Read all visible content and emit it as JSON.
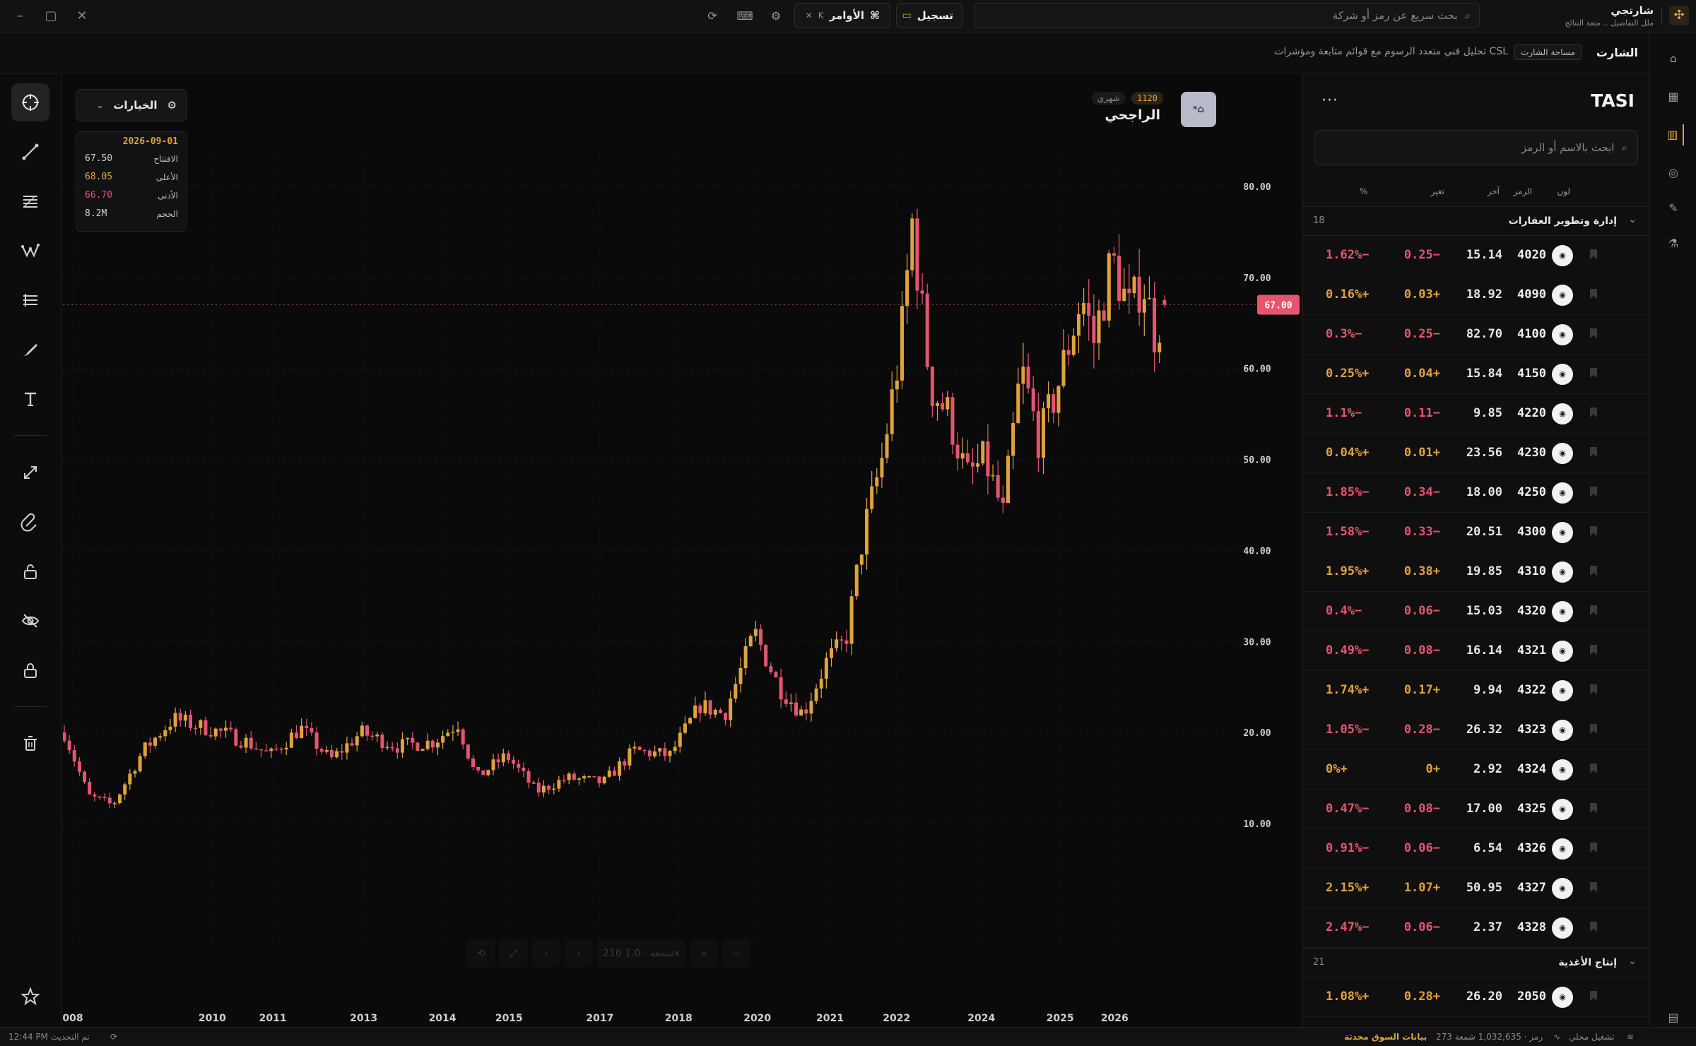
{
  "brand": {
    "name": "شارتجي",
    "tagline": "ملل التفاصيل .. متعة النتائج"
  },
  "topbar": {
    "search_placeholder": "بحث سريع عن رمز أو شركة",
    "record_label": "تسجيل",
    "commands_label": "الأوامر",
    "commands_shortcut": "⌘",
    "commands_kbd": "K"
  },
  "subheader": {
    "title": "الشارت",
    "badge": "مساحة الشارت",
    "description": "تحليل فني متعدد الرسوم مع قوائم متابعة ومؤشرات CSL"
  },
  "chart_header": {
    "options_label": "الخيارات",
    "symbol_name": "الراجحي",
    "symbol_code": "1120",
    "timeframe": "شهري",
    "ohlc": {
      "date": "2026-09-01",
      "open_label": "الافتتاح",
      "open": "67.50",
      "high_label": "الأعلى",
      "high": "68.05",
      "low_label": "الأدنى",
      "low": "66.70",
      "volume_label": "الحجم",
      "volume": "8.2M"
    },
    "bottom_toolbar": {
      "count_text": "216 شمعة · 1.0x"
    }
  },
  "chart_data": {
    "type": "candlestick",
    "ylim": [
      5,
      86
    ],
    "y_ticks": [
      "10.00",
      "20.00",
      "30.00",
      "40.00",
      "50.00",
      "60.00",
      "70.00",
      "80.00"
    ],
    "x_ticks": [
      "008",
      "2010",
      "2011",
      "2013",
      "2014",
      "2015",
      "2017",
      "2018",
      "2020",
      "2021",
      "2022",
      "2024",
      "2025",
      "2026"
    ],
    "last_price": "67.00",
    "colors": {
      "up": "#e0a23b",
      "down": "#e5556d",
      "last": "#e5556d"
    },
    "anchors": [
      {
        "t": 2008.0,
        "v": 20
      },
      {
        "t": 2008.4,
        "v": 13
      },
      {
        "t": 2008.8,
        "v": 12
      },
      {
        "t": 2009.3,
        "v": 18
      },
      {
        "t": 2009.8,
        "v": 21.5
      },
      {
        "t": 2010.6,
        "v": 20
      },
      {
        "t": 2011.0,
        "v": 19
      },
      {
        "t": 2011.4,
        "v": 17.5
      },
      {
        "t": 2011.9,
        "v": 20.5
      },
      {
        "t": 2012.4,
        "v": 17
      },
      {
        "t": 2012.9,
        "v": 20
      },
      {
        "t": 2013.5,
        "v": 18.5
      },
      {
        "t": 2014.1,
        "v": 19
      },
      {
        "t": 2014.5,
        "v": 21
      },
      {
        "t": 2014.8,
        "v": 15
      },
      {
        "t": 2015.3,
        "v": 17.5
      },
      {
        "t": 2015.8,
        "v": 13.5
      },
      {
        "t": 2016.3,
        "v": 15
      },
      {
        "t": 2016.9,
        "v": 14.5
      },
      {
        "t": 2017.4,
        "v": 18
      },
      {
        "t": 2018.0,
        "v": 17.5
      },
      {
        "t": 2018.5,
        "v": 23
      },
      {
        "t": 2018.9,
        "v": 22
      },
      {
        "t": 2019.4,
        "v": 31
      },
      {
        "t": 2019.8,
        "v": 25
      },
      {
        "t": 2020.2,
        "v": 22
      },
      {
        "t": 2020.6,
        "v": 28
      },
      {
        "t": 2020.9,
        "v": 30
      },
      {
        "t": 2021.2,
        "v": 42
      },
      {
        "t": 2021.5,
        "v": 50
      },
      {
        "t": 2021.8,
        "v": 62
      },
      {
        "t": 2022.0,
        "v": 76
      },
      {
        "t": 2022.3,
        "v": 58
      },
      {
        "t": 2022.6,
        "v": 55
      },
      {
        "t": 2022.9,
        "v": 48
      },
      {
        "t": 2023.2,
        "v": 50
      },
      {
        "t": 2023.5,
        "v": 44
      },
      {
        "t": 2023.8,
        "v": 60
      },
      {
        "t": 2024.1,
        "v": 52
      },
      {
        "t": 2024.4,
        "v": 58
      },
      {
        "t": 2024.8,
        "v": 68
      },
      {
        "t": 2025.0,
        "v": 63
      },
      {
        "t": 2025.3,
        "v": 72
      },
      {
        "t": 2025.6,
        "v": 66
      },
      {
        "t": 2025.8,
        "v": 70
      },
      {
        "t": 2026.0,
        "v": 64
      },
      {
        "t": 2026.2,
        "v": 67
      }
    ]
  },
  "watchlist": {
    "title": "TASI",
    "more_label": "···",
    "search_placeholder": "ابحث بالاسم أو الرمز",
    "columns": {
      "color": "لون",
      "symbol": "الرمز",
      "last": "آخر",
      "change": "تغير",
      "pct": "%"
    },
    "groups": [
      {
        "name": "إدارة وتطوير العقارات",
        "count": "18",
        "rows": [
          {
            "code": "4020",
            "last": "15.14",
            "chg": "0.25−",
            "pct": "1.62%−",
            "dir": "down"
          },
          {
            "code": "4090",
            "last": "18.92",
            "chg": "0.03+",
            "pct": "0.16%+",
            "dir": "up"
          },
          {
            "code": "4100",
            "last": "82.70",
            "chg": "0.25−",
            "pct": "0.3%−",
            "dir": "down"
          },
          {
            "code": "4150",
            "last": "15.84",
            "chg": "0.04+",
            "pct": "0.25%+",
            "dir": "up"
          },
          {
            "code": "4220",
            "last": "9.85",
            "chg": "0.11−",
            "pct": "1.1%−",
            "dir": "down"
          },
          {
            "code": "4230",
            "last": "23.56",
            "chg": "0.01+",
            "pct": "0.04%+",
            "dir": "up"
          },
          {
            "code": "4250",
            "last": "18.00",
            "chg": "0.34−",
            "pct": "1.85%−",
            "dir": "down"
          },
          {
            "code": "4300",
            "last": "20.51",
            "chg": "0.33−",
            "pct": "1.58%−",
            "dir": "down"
          },
          {
            "code": "4310",
            "last": "19.85",
            "chg": "0.38+",
            "pct": "1.95%+",
            "dir": "up"
          },
          {
            "code": "4320",
            "last": "15.03",
            "chg": "0.06−",
            "pct": "0.4%−",
            "dir": "down"
          },
          {
            "code": "4321",
            "last": "16.14",
            "chg": "0.08−",
            "pct": "0.49%−",
            "dir": "down"
          },
          {
            "code": "4322",
            "last": "9.94",
            "chg": "0.17+",
            "pct": "1.74%+",
            "dir": "up"
          },
          {
            "code": "4323",
            "last": "26.32",
            "chg": "0.28−",
            "pct": "1.05%−",
            "dir": "down"
          },
          {
            "code": "4324",
            "last": "2.92",
            "chg": "0+",
            "pct": "0%+",
            "dir": "up"
          },
          {
            "code": "4325",
            "last": "17.00",
            "chg": "0.08−",
            "pct": "0.47%−",
            "dir": "down"
          },
          {
            "code": "4326",
            "last": "6.54",
            "chg": "0.06−",
            "pct": "0.91%−",
            "dir": "down"
          },
          {
            "code": "4327",
            "last": "50.95",
            "chg": "1.07+",
            "pct": "2.15%+",
            "dir": "up"
          },
          {
            "code": "4328",
            "last": "2.37",
            "chg": "0.06−",
            "pct": "2.47%−",
            "dir": "down"
          }
        ]
      },
      {
        "name": "إنتاج الأغذية",
        "count": "21",
        "rows": [
          {
            "code": "2050",
            "last": "26.20",
            "chg": "0.28+",
            "pct": "1.08%+",
            "dir": "up"
          }
        ]
      }
    ]
  },
  "status": {
    "market": "بيانات السوق محدثة",
    "stats": "273 رمز · 1,032,635 شمعة",
    "mode": "تشغيل محلي",
    "updated": "12:44 PM تم التحديث"
  }
}
